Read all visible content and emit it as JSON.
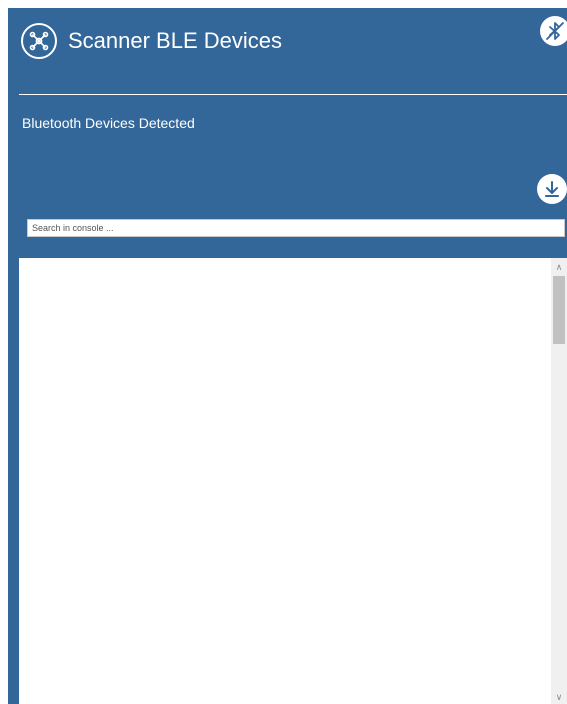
{
  "header": {
    "title": "Scanner BLE Devices",
    "logo_icon": "network-hub-icon",
    "top_action_icon": "bluetooth-off-icon"
  },
  "section": {
    "title": "Bluetooth Devices Detected",
    "download_icon": "download-icon"
  },
  "search": {
    "placeholder": "Search in console ...",
    "value": ""
  },
  "console": {
    "lines": []
  },
  "colors": {
    "background": "#336699",
    "foreground": "#ffffff"
  }
}
